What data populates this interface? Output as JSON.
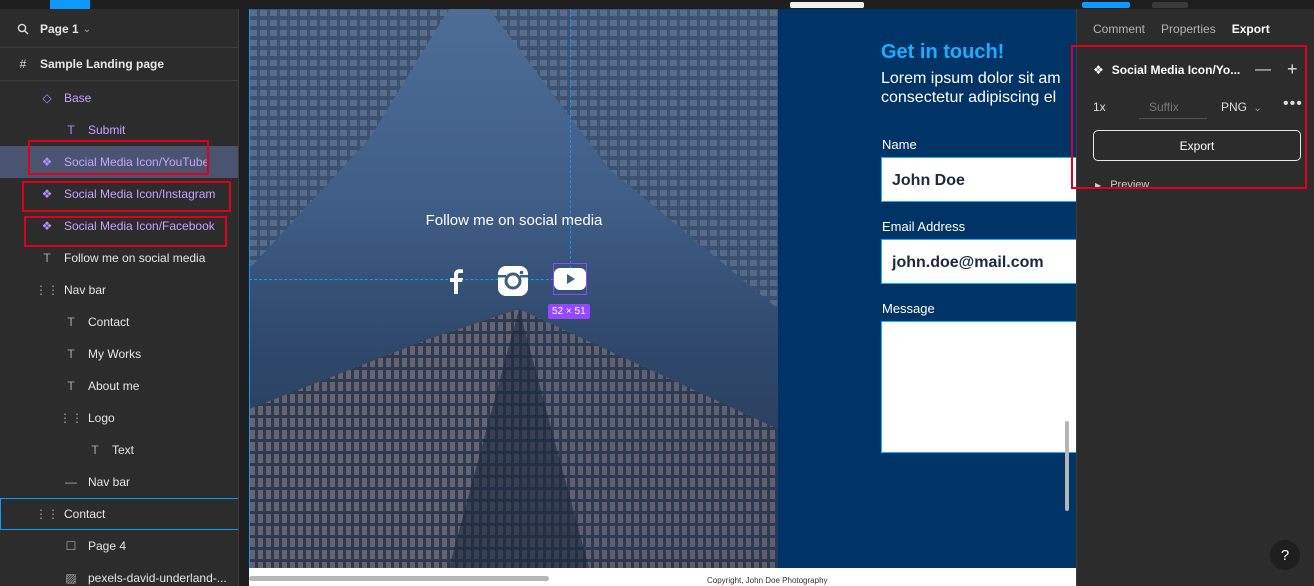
{
  "layers": {
    "page_name": "Page 1",
    "frame_name": "Sample Landing page",
    "items": [
      {
        "label": "Base",
        "indent": 1
      },
      {
        "label": "Submit",
        "indent": 2
      },
      {
        "label": "Social Media Icon/YouTube",
        "indent": 1
      },
      {
        "label": "Social Media Icon/Instagram",
        "indent": 1
      },
      {
        "label": "Social Media Icon/Facebook",
        "indent": 1
      },
      {
        "label": "Follow me on social media",
        "indent": 1
      },
      {
        "label": "Nav bar",
        "indent": 1
      },
      {
        "label": "Contact",
        "indent": 2
      },
      {
        "label": "My Works",
        "indent": 2
      },
      {
        "label": "About me",
        "indent": 2
      },
      {
        "label": "Logo",
        "indent": 2
      },
      {
        "label": "Text",
        "indent": 3
      },
      {
        "label": "Nav bar",
        "indent": 2
      },
      {
        "label": "Contact",
        "indent": 1
      },
      {
        "label": "Page 4",
        "indent": 2
      },
      {
        "label": "pexels-david-underland-...",
        "indent": 2
      }
    ]
  },
  "canvas": {
    "follow_text": "Follow me on social media",
    "dimension_badge": "52 × 51",
    "contact_heading": "Get in touch!",
    "contact_lorem_1": "Lorem ipsum dolor sit am",
    "contact_lorem_2": "consectetur adipiscing el",
    "name_label": "Name",
    "name_value": "John Doe",
    "email_label": "Email Address",
    "email_value": "john.doe@mail.com",
    "message_label": "Message",
    "footer_text": "Copyright, John Doe Photography"
  },
  "right_panel": {
    "tabs": [
      "Comment",
      "Properties",
      "Export"
    ],
    "active_tab": "Export",
    "selection_title": "Social Media Icon/Yo...",
    "scale": "1x",
    "suffix_placeholder": "Suffix",
    "format": "PNG",
    "export_button": "Export",
    "preview_label": "Preview",
    "help": "?"
  },
  "colors": {
    "accent_blue": "#0d99ff",
    "component_purple": "#9747ff",
    "highlight_red": "#e0001b",
    "site_navy": "#013466",
    "site_cyan": "#19aeff"
  }
}
